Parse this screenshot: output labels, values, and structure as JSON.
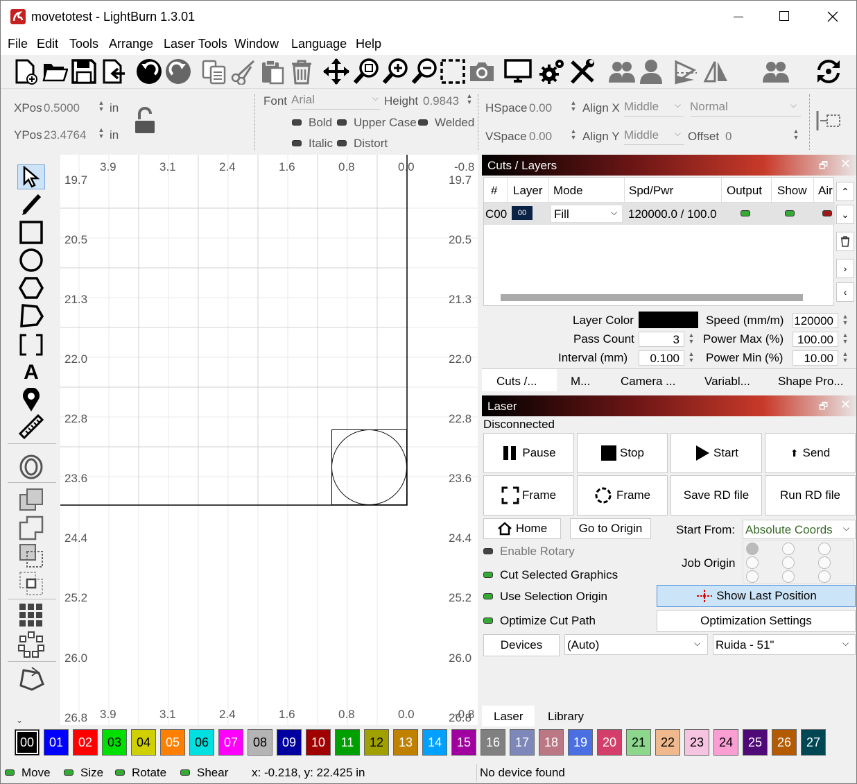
{
  "window": {
    "title": "movetotest - LightBurn 1.3.01"
  },
  "menu": {
    "items": [
      "File",
      "Edit",
      "Tools",
      "Arrange",
      "Laser Tools",
      "Window",
      "Language",
      "Help"
    ]
  },
  "toolbar": {
    "icons": [
      "new-file-icon",
      "open-folder-icon",
      "save-icon",
      "import-icon",
      "undo-icon",
      "redo-icon",
      "copy-icon",
      "cut-icon",
      "paste-icon",
      "delete-icon",
      "move-icon",
      "zoom-selection-icon",
      "zoom-in-icon",
      "zoom-out-icon",
      "zoom-frame-icon",
      "camera-icon",
      "monitor-icon",
      "settings-icon",
      "tools-icon",
      "group-icon",
      "user-icon",
      "mirror-horizontal-icon",
      "mirror-vertical-icon",
      "ungroup-icon",
      "refresh-icon"
    ]
  },
  "props": {
    "xpos_label": "XPos",
    "xpos": "0.5000",
    "ypos_label": "YPos",
    "ypos": "23.4764",
    "unit": "in",
    "font_label": "Font",
    "font": "Arial",
    "height_label": "Height",
    "height": "0.9843",
    "bold": "Bold",
    "upper_case": "Upper Case",
    "welded": "Welded",
    "italic": "Italic",
    "distort": "Distort",
    "hspace_label": "HSpace",
    "hspace": "0.00",
    "vspace_label": "VSpace",
    "vspace": "0.00",
    "alignx_label": "Align X",
    "alignx": "Middle",
    "aligny_label": "Align Y",
    "aligny": "Middle",
    "normal": "Normal",
    "offset_label": "Offset",
    "offset": "0"
  },
  "ruler": {
    "top": [
      "3.9",
      "3.1",
      "2.4",
      "1.6",
      "0.8",
      "0.0",
      "-0.8"
    ],
    "bottom": [
      "3.9",
      "3.1",
      "2.4",
      "1.6",
      "0.8",
      "0.0",
      "-0.8"
    ],
    "left": [
      "19.7",
      "20.5",
      "21.3",
      "22.0",
      "22.8",
      "23.6",
      "24.4",
      "25.2",
      "26.0",
      "26.8"
    ],
    "right": [
      "19.7",
      "20.5",
      "21.3",
      "22.0",
      "22.8",
      "23.6",
      "24.4",
      "25.2",
      "26.0",
      "26.8"
    ]
  },
  "cuts": {
    "title": "Cuts / Layers",
    "headers": [
      "#",
      "Layer",
      "Mode",
      "Spd/Pwr",
      "Output",
      "Show",
      "Air"
    ],
    "row": {
      "num": "C00",
      "layer": "00",
      "mode": "Fill",
      "spdpwr": "120000.0 / 100.0"
    },
    "layer_color_label": "Layer Color",
    "speed_label": "Speed (mm/m)",
    "speed": "120000",
    "pass_label": "Pass Count",
    "pass": "3",
    "pmax_label": "Power Max (%)",
    "pmax": "100.00",
    "interval_label": "Interval (mm)",
    "interval": "0.100",
    "pmin_label": "Power Min (%)",
    "pmin": "10.00",
    "tabs": [
      "Cuts /...",
      "M...",
      "Camera ...",
      "Variabl...",
      "Shape Pro..."
    ]
  },
  "laser": {
    "title": "Laser",
    "status": "Disconnected",
    "pause": "Pause",
    "stop": "Stop",
    "start": "Start",
    "send": "Send",
    "frame1": "Frame",
    "frame2": "Frame",
    "save_rd": "Save RD file",
    "run_rd": "Run RD file",
    "home": "Home",
    "go_origin": "Go to Origin",
    "start_from_label": "Start From:",
    "start_from": "Absolute Coords",
    "enable_rotary": "Enable Rotary",
    "job_origin": "Job Origin",
    "cut_selected": "Cut Selected Graphics",
    "use_sel_origin": "Use Selection Origin",
    "optimize": "Optimize Cut Path",
    "show_last": "Show Last Position",
    "opt_settings": "Optimization Settings",
    "devices": "Devices",
    "auto": "(Auto)",
    "device": "Ruida - 51\"",
    "bottom_tabs": [
      "Laser",
      "Library"
    ]
  },
  "palette": {
    "labels": [
      "00",
      "01",
      "02",
      "03",
      "04",
      "05",
      "06",
      "07",
      "08",
      "09",
      "10",
      "11",
      "12",
      "13",
      "14",
      "15",
      "16",
      "17",
      "18",
      "19",
      "20",
      "21",
      "22",
      "23",
      "24",
      "25",
      "26",
      "27"
    ],
    "colors": [
      "#000000",
      "#0000ff",
      "#ff0000",
      "#00e000",
      "#d0d000",
      "#ff8000",
      "#00e0e0",
      "#ff00ff",
      "#b4b4b4",
      "#0000a0",
      "#a00000",
      "#00a000",
      "#a0a000",
      "#c08000",
      "#00a0ff",
      "#a000a0",
      "#808080",
      "#7d87b9",
      "#bb7784",
      "#4a6fe3",
      "#d33f6a",
      "#8cd78c",
      "#f0b98d",
      "#f6c4e1",
      "#fa9ed4",
      "#500a78",
      "#b45a00",
      "#004754"
    ]
  },
  "status": {
    "move": "Move",
    "size": "Size",
    "rotate": "Rotate",
    "shear": "Shear",
    "coords": "x: -0.218, y: 22.425 in",
    "device": "No device found"
  }
}
